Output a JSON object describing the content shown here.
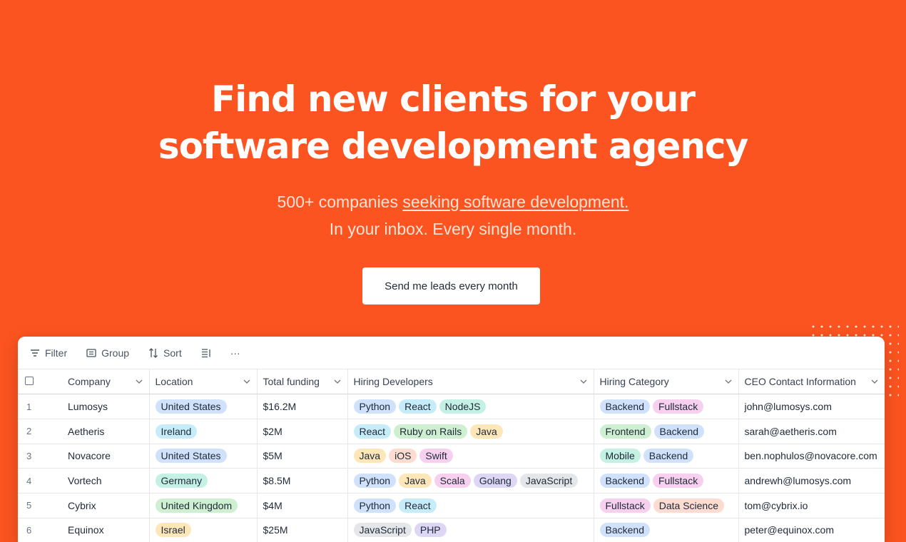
{
  "hero": {
    "title_line1": "Find new clients for your",
    "title_line2": "software development agency",
    "sub_prefix": "500+ companies ",
    "sub_link": "seeking software development.",
    "sub_line2": "In your inbox. Every single month.",
    "cta_label": "Send me leads every month"
  },
  "toolbar": {
    "filter": "Filter",
    "group": "Group",
    "sort": "Sort",
    "more": "···"
  },
  "columns": {
    "company": "Company",
    "location": "Location",
    "funding": "Total funding",
    "hiring_devs": "Hiring Developers",
    "hiring_cat": "Hiring Category",
    "ceo": "CEO Contact Information"
  },
  "rows": [
    {
      "num": "1",
      "company": "Lumosys",
      "location": {
        "text": "United States",
        "color": "blue"
      },
      "funding": "$16.2M",
      "devs": [
        {
          "text": "Python",
          "color": "blue"
        },
        {
          "text": "React",
          "color": "cyan"
        },
        {
          "text": "NodeJS",
          "color": "teal"
        }
      ],
      "cats": [
        {
          "text": "Backend",
          "color": "blue"
        },
        {
          "text": "Fullstack",
          "color": "pink"
        }
      ],
      "ceo": "john@lumosys.com"
    },
    {
      "num": "2",
      "company": "Aetheris",
      "location": {
        "text": "Ireland",
        "color": "cyan"
      },
      "funding": "$2M",
      "devs": [
        {
          "text": "React",
          "color": "cyan"
        },
        {
          "text": "Ruby on Rails",
          "color": "green"
        },
        {
          "text": "Java",
          "color": "yellow"
        }
      ],
      "cats": [
        {
          "text": "Frontend",
          "color": "green"
        },
        {
          "text": "Backend",
          "color": "blue"
        }
      ],
      "ceo": "sarah@aetheris.com"
    },
    {
      "num": "3",
      "company": "Novacore",
      "location": {
        "text": "United States",
        "color": "blue"
      },
      "funding": "$5M",
      "devs": [
        {
          "text": "Java",
          "color": "yellow"
        },
        {
          "text": "iOS",
          "color": "peach"
        },
        {
          "text": "Swift",
          "color": "pink"
        }
      ],
      "cats": [
        {
          "text": "Mobile",
          "color": "teal"
        },
        {
          "text": "Backend",
          "color": "blue"
        }
      ],
      "ceo": "ben.nophulos@novacore.com"
    },
    {
      "num": "4",
      "company": "Vortech",
      "location": {
        "text": "Germany",
        "color": "teal"
      },
      "funding": "$8.5M",
      "devs": [
        {
          "text": "Python",
          "color": "blue"
        },
        {
          "text": "Java",
          "color": "yellow"
        },
        {
          "text": "Scala",
          "color": "pink"
        },
        {
          "text": "Golang",
          "color": "lav"
        },
        {
          "text": "JavaScript",
          "color": "gray"
        }
      ],
      "cats": [
        {
          "text": "Backend",
          "color": "blue"
        },
        {
          "text": "Fullstack",
          "color": "pink"
        }
      ],
      "ceo": "andrewh@lumosys.com"
    },
    {
      "num": "5",
      "company": "Cybrix",
      "location": {
        "text": "United Kingdom",
        "color": "green"
      },
      "funding": "$4M",
      "devs": [
        {
          "text": "Python",
          "color": "blue"
        },
        {
          "text": "React",
          "color": "cyan"
        }
      ],
      "cats": [
        {
          "text": "Fullstack",
          "color": "pink"
        },
        {
          "text": "Data Science",
          "color": "peach"
        }
      ],
      "ceo": "tom@cybrix.io"
    },
    {
      "num": "6",
      "company": "Equinox",
      "location": {
        "text": "Israel",
        "color": "yellow"
      },
      "funding": "$25M",
      "devs": [
        {
          "text": "JavaScript",
          "color": "gray"
        },
        {
          "text": "PHP",
          "color": "lav"
        }
      ],
      "cats": [
        {
          "text": "Backend",
          "color": "blue"
        }
      ],
      "ceo": "peter@equinox.com"
    }
  ],
  "colors": {
    "background": "#fc5420",
    "blue": "#d0e2fb",
    "cyan": "#c7ecf9",
    "teal": "#c5f1e5",
    "green": "#cfefd1",
    "yellow": "#fde6b8",
    "peach": "#fcdcd0",
    "pink": "#f7d0f0",
    "lav": "#ddd7f5",
    "gray": "#e4e6ea"
  }
}
